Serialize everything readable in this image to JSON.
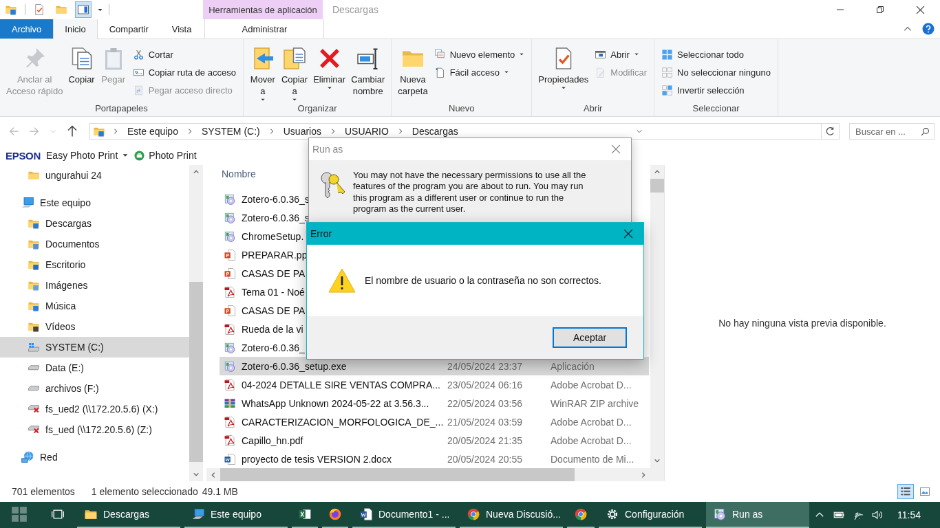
{
  "window": {
    "title": "Descargas",
    "context_header": "Herramientas de aplicación"
  },
  "quick_access": [
    {
      "kind": "folder-down",
      "selected": false
    },
    {
      "kind": "properties",
      "selected": false
    },
    {
      "kind": "folder",
      "selected": false
    },
    {
      "kind": "pane",
      "selected": true
    }
  ],
  "tabs": [
    {
      "label": "Archivo",
      "kind": "file",
      "selected": false
    },
    {
      "label": "Inicio",
      "kind": "normal",
      "selected": true
    },
    {
      "label": "Compartir",
      "kind": "normal",
      "selected": false
    },
    {
      "label": "Vista",
      "kind": "normal",
      "selected": false
    },
    {
      "label": "Administrar",
      "kind": "context",
      "selected": false
    }
  ],
  "ribbon": [
    {
      "label": "Portapapeles",
      "large": [
        {
          "label": "Anclar al\nAcceso rápido",
          "kind": "pin",
          "disabled": true
        },
        {
          "label": "Copiar",
          "kind": "copy",
          "disabled": false
        },
        {
          "label": "Pegar",
          "kind": "paste",
          "disabled": true
        }
      ],
      "small": [
        {
          "label": "Cortar",
          "kind": "cut",
          "disabled": false
        },
        {
          "label": "Copiar ruta de acceso",
          "kind": "copy-path",
          "disabled": false
        },
        {
          "label": "Pegar acceso directo",
          "kind": "paste-shortcut",
          "disabled": true
        }
      ]
    },
    {
      "label": "Organizar",
      "large": [
        {
          "label": "Mover\na",
          "kind": "move",
          "disabled": false,
          "dropdown": true
        },
        {
          "label": "Copiar\na",
          "kind": "copy-to",
          "disabled": false,
          "dropdown": true
        },
        {
          "label": "Eliminar",
          "kind": "delete",
          "disabled": false,
          "dropdown": true
        },
        {
          "label": "Cambiar\nnombre",
          "kind": "rename",
          "disabled": false
        }
      ]
    },
    {
      "label": "Nuevo",
      "large": [
        {
          "label": "Nueva\ncarpeta",
          "kind": "new-folder",
          "disabled": false
        }
      ],
      "small": [
        {
          "label": "Nuevo elemento",
          "kind": "new-item",
          "disabled": false,
          "dropdown": true
        },
        {
          "label": "Fácil acceso",
          "kind": "easy-access",
          "disabled": false,
          "dropdown": true
        }
      ]
    },
    {
      "label": "Abrir",
      "large": [
        {
          "label": "Propiedades",
          "kind": "properties",
          "disabled": false,
          "dropdown": true
        }
      ],
      "small": [
        {
          "label": "Abrir",
          "kind": "open",
          "disabled": false,
          "dropdown": true
        },
        {
          "label": "Modificar",
          "kind": "edit",
          "disabled": true
        }
      ]
    },
    {
      "label": "Seleccionar",
      "small": [
        {
          "label": "Seleccionar todo",
          "kind": "select-all",
          "disabled": false
        },
        {
          "label": "No seleccionar ninguno",
          "kind": "select-none",
          "disabled": false
        },
        {
          "label": "Invertir selección",
          "kind": "invert",
          "disabled": false
        }
      ]
    }
  ],
  "address": {
    "crumbs": [
      "Este equipo",
      "SYSTEM (C:)",
      "Usuarios",
      "USUARIO",
      "Descargas"
    ],
    "search_placeholder": "Buscar en ..."
  },
  "epson_toolbar": {
    "brand": "EPSON",
    "menu": "Easy Photo Print",
    "button": "Photo Print"
  },
  "sidebar": {
    "scrolled_children": [
      {
        "label": "ungurahui 24",
        "kind": "folder",
        "selected": false
      }
    ],
    "items": [
      {
        "label": "Este equipo",
        "kind": "pc",
        "selected": false,
        "children": [
          {
            "label": "Descargas",
            "kind": "downloads",
            "selected": false
          },
          {
            "label": "Documentos",
            "kind": "documents",
            "selected": false
          },
          {
            "label": "Escritorio",
            "kind": "desktop",
            "selected": false
          },
          {
            "label": "Imágenes",
            "kind": "pictures",
            "selected": false
          },
          {
            "label": "Música",
            "kind": "music",
            "selected": false
          },
          {
            "label": "Vídeos",
            "kind": "videos",
            "selected": false
          },
          {
            "label": "SYSTEM (C:)",
            "kind": "system-drive",
            "selected": true
          },
          {
            "label": "Data (E:)",
            "kind": "drive",
            "selected": false
          },
          {
            "label": "archivos (F:)",
            "kind": "drive",
            "selected": false
          },
          {
            "label": "fs_ued2 (\\\\172.20.5.6) (X:)",
            "kind": "network-drive-error",
            "selected": false
          },
          {
            "label": "fs_ued (\\\\172.20.5.6) (Z:)",
            "kind": "network-drive-error",
            "selected": false
          }
        ]
      },
      {
        "label": "Red",
        "kind": "network",
        "selected": false
      }
    ]
  },
  "file_list": {
    "columns": [
      "Nombre"
    ],
    "rows": [
      {
        "name": "Zotero-6.0.36_s",
        "kind": "exe",
        "selected": false
      },
      {
        "name": "Zotero-6.0.36_s",
        "kind": "exe",
        "selected": false
      },
      {
        "name": "ChromeSetup.",
        "kind": "exe",
        "selected": false
      },
      {
        "name": "PREPARAR.pp",
        "kind": "ppt",
        "selected": false
      },
      {
        "name": "CASAS DE PA",
        "kind": "ppt",
        "selected": false
      },
      {
        "name": "Tema 01 - Noé",
        "kind": "pdf",
        "selected": false
      },
      {
        "name": "CASAS DE PA",
        "kind": "ppt",
        "selected": false
      },
      {
        "name": "Rueda de la vi",
        "kind": "pdf",
        "selected": false
      },
      {
        "name": "Zotero-6.0.36_",
        "kind": "exe",
        "selected": false
      },
      {
        "name": "Zotero-6.0.36_setup.exe",
        "date": "24/05/2024 23:37",
        "type": "Aplicación",
        "kind": "exe",
        "selected": true
      },
      {
        "name": "04-2024 DETALLE SIRE VENTAS COMPRA...",
        "date": "23/05/2024 06:16",
        "type": "Adobe Acrobat D...",
        "kind": "pdf",
        "selected": false
      },
      {
        "name": "WhatsApp Unknown 2024-05-22 at 3.56.3...",
        "date": "22/05/2024 03:56",
        "type": "WinRAR ZIP archive",
        "kind": "zip",
        "selected": false
      },
      {
        "name": "CARACTERIZACION_MORFOLOGICA_DE_...",
        "date": "21/05/2024 03:59",
        "type": "Adobe Acrobat D...",
        "kind": "pdf",
        "selected": false
      },
      {
        "name": "Capillo_hn.pdf",
        "date": "20/05/2024 21:35",
        "type": "Adobe Acrobat D...",
        "kind": "pdf",
        "selected": false
      },
      {
        "name": "proyecto de tesis VERSION 2.docx",
        "date": "20/05/2024 20:55",
        "type": "Documento de Mi...",
        "kind": "doc",
        "selected": false
      }
    ]
  },
  "preview": {
    "message": "No hay ninguna vista previa disponible."
  },
  "status_bar": {
    "count": "701 elementos",
    "selection": "1 elemento seleccionado",
    "size": "49.1 MB",
    "views": [
      {
        "kind": "details",
        "selected": true
      },
      {
        "kind": "tiles",
        "selected": false
      }
    ]
  },
  "run_as_dialog": {
    "title": "Run as",
    "message": "You may not have the necessary permissions to use all the features of the program you are about to run. You may run this program as a different user or continue to run the program as the current user."
  },
  "error_dialog": {
    "title": "Error",
    "message": "El nombre de usuario o la contraseña no son correctos.",
    "button": "Aceptar"
  },
  "taskbar": {
    "items": [
      {
        "kind": "start",
        "running": false,
        "active": false
      },
      {
        "kind": "task-view",
        "running": false,
        "active": false
      },
      {
        "kind": "explorer",
        "label": "Descargas",
        "running": true,
        "active": false
      },
      {
        "kind": "pc",
        "label": "Este equipo",
        "running": true,
        "active": false
      },
      {
        "kind": "excel",
        "running": true,
        "active": false
      },
      {
        "kind": "firefox",
        "running": true,
        "active": false
      },
      {
        "kind": "word",
        "label": "Documento1 - ...",
        "running": true,
        "active": false
      },
      {
        "kind": "chrome",
        "label": "Nueva Discusió...",
        "running": true,
        "active": false
      },
      {
        "kind": "chrome",
        "running": true,
        "active": false
      },
      {
        "kind": "settings",
        "label": "Configuración",
        "running": true,
        "active": false
      },
      {
        "kind": "runas",
        "label": "Run as",
        "running": true,
        "active": true
      }
    ],
    "tray": [
      {
        "kind": "caret"
      },
      {
        "kind": "battery"
      },
      {
        "kind": "wifi"
      },
      {
        "kind": "volume"
      }
    ],
    "clock": "11:54"
  }
}
